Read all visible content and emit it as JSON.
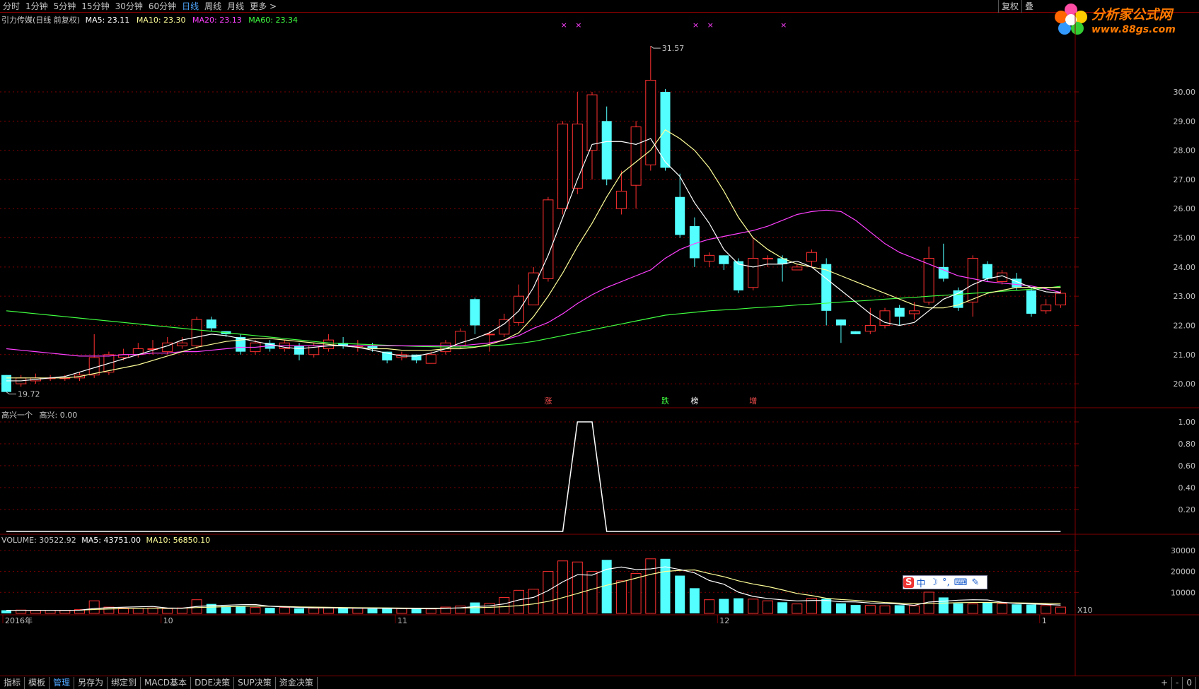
{
  "toolbar": {
    "periods": [
      "分时",
      "1分钟",
      "5分钟",
      "15分钟",
      "30分钟",
      "60分钟",
      "日线",
      "周线",
      "月线",
      "更多 >"
    ],
    "active": "日线",
    "right": [
      "复权",
      "叠"
    ]
  },
  "logo": {
    "name": "分析家公式网",
    "url": "www.88gs.com"
  },
  "main_panel": {
    "title": "引力传媒(日线 前复权)",
    "ma5": "MA5: 23.11",
    "ma10": "MA10: 23.30",
    "ma20": "MA20: 23.13",
    "ma60": "MA60: 23.34",
    "high_label": "31.57",
    "low_label": "19.72",
    "markers": [
      "涨",
      "跌",
      "榜",
      "增"
    ]
  },
  "indicator_panel": {
    "title": "高兴一个",
    "value": "高兴: 0.00"
  },
  "volume_panel": {
    "vol": "VOLUME: 30522.92",
    "ma5": "MA5: 43751.00",
    "ma10": "MA10: 56850.10",
    "unit": "X10"
  },
  "bottom_tabs": [
    "指标",
    "模板",
    "管理",
    "另存为",
    "绑定到",
    "MACD基本",
    "DDE决策",
    "SUP决策",
    "资金决策"
  ],
  "bottom_right": [
    "+",
    "-",
    "0"
  ],
  "x_axis": {
    "labels": [
      "2016年",
      "10",
      "11",
      "12",
      "1"
    ]
  },
  "colors": {
    "up": "#ff3030",
    "down": "#54ffff",
    "ma5": "#ffffff",
    "ma10": "#ffff99",
    "ma20": "#ff40ff",
    "ma60": "#40ff40",
    "grid": "#800000"
  },
  "chart_data": [
    {
      "type": "candlestick",
      "title": "引力传媒(日线 前复权)",
      "y_ticks": [
        "20.00",
        "21.00",
        "22.00",
        "23.00",
        "24.00",
        "25.00",
        "26.00",
        "27.00",
        "28.00",
        "29.00",
        "30.00"
      ],
      "ylim": [
        19.3,
        32.3
      ],
      "candles": [
        [
          20.3,
          19.72,
          20.3,
          19.72
        ],
        [
          20.0,
          20.2,
          20.3,
          19.9
        ],
        [
          20.1,
          20.2,
          20.35,
          20.0
        ],
        [
          20.2,
          20.2,
          20.3,
          20.1
        ],
        [
          20.2,
          20.2,
          20.3,
          20.1
        ],
        [
          20.2,
          20.3,
          20.4,
          20.1
        ],
        [
          20.3,
          20.9,
          21.7,
          20.2
        ],
        [
          20.4,
          21.0,
          21.1,
          20.3
        ],
        [
          20.9,
          21.0,
          21.2,
          20.8
        ],
        [
          21.0,
          21.2,
          21.4,
          20.9
        ],
        [
          21.2,
          21.2,
          21.5,
          21.0
        ],
        [
          21.1,
          21.4,
          21.6,
          21.0
        ],
        [
          21.3,
          21.4,
          21.6,
          21.2
        ],
        [
          21.3,
          22.2,
          22.3,
          21.2
        ],
        [
          22.2,
          21.9,
          22.3,
          21.8
        ],
        [
          21.8,
          21.7,
          21.8,
          21.6
        ],
        [
          21.6,
          21.1,
          21.7,
          21.0
        ],
        [
          21.1,
          21.4,
          21.5,
          21.0
        ],
        [
          21.4,
          21.2,
          21.5,
          21.1
        ],
        [
          21.2,
          21.4,
          21.5,
          21.1
        ],
        [
          21.3,
          21.0,
          21.4,
          20.8
        ],
        [
          21.0,
          21.3,
          21.4,
          20.9
        ],
        [
          21.2,
          21.5,
          21.7,
          21.1
        ],
        [
          21.4,
          21.3,
          21.6,
          21.2
        ],
        [
          21.3,
          21.3,
          21.5,
          21.1
        ],
        [
          21.3,
          21.2,
          21.4,
          21.1
        ],
        [
          21.1,
          20.8,
          21.1,
          20.7
        ],
        [
          20.9,
          21.0,
          21.1,
          20.8
        ],
        [
          21.0,
          20.8,
          21.0,
          20.7
        ],
        [
          20.7,
          21.0,
          21.1,
          20.7
        ],
        [
          21.1,
          21.4,
          21.5,
          21.0
        ],
        [
          21.3,
          21.8,
          21.9,
          21.2
        ],
        [
          22.9,
          22.0,
          22.95,
          21.7
        ],
        [
          21.7,
          21.7,
          21.8,
          21.1
        ],
        [
          21.7,
          22.2,
          22.4,
          21.6
        ],
        [
          22.1,
          23.0,
          23.4,
          22.0
        ],
        [
          22.7,
          23.8,
          24.0,
          22.7
        ],
        [
          23.6,
          26.3,
          26.4,
          23.5
        ],
        [
          26.0,
          28.9,
          29.0,
          25.8
        ],
        [
          26.7,
          28.9,
          30.0,
          26.5
        ],
        [
          28.0,
          29.9,
          30.0,
          27.0
        ],
        [
          29.0,
          27.0,
          29.5,
          26.8
        ],
        [
          26.0,
          26.6,
          27.3,
          25.8
        ],
        [
          26.8,
          28.8,
          29.0,
          26.0
        ],
        [
          27.5,
          30.4,
          31.57,
          27.3
        ],
        [
          30.0,
          27.4,
          30.1,
          27.3
        ],
        [
          26.4,
          25.1,
          27.2,
          25.0
        ],
        [
          25.4,
          24.3,
          25.7,
          24.0
        ],
        [
          24.2,
          24.4,
          24.5,
          24.0
        ],
        [
          24.4,
          24.1,
          24.4,
          23.9
        ],
        [
          24.2,
          23.2,
          24.3,
          23.1
        ],
        [
          23.3,
          24.3,
          25.0,
          23.2
        ],
        [
          24.3,
          24.3,
          24.4,
          24.0
        ],
        [
          24.3,
          24.1,
          24.4,
          23.5
        ],
        [
          23.9,
          24.0,
          24.1,
          23.9
        ],
        [
          24.2,
          24.5,
          24.6,
          24.0
        ],
        [
          24.1,
          22.5,
          24.3,
          22.0
        ],
        [
          22.2,
          22.0,
          22.2,
          21.4
        ],
        [
          21.8,
          21.7,
          21.8,
          21.7
        ],
        [
          21.8,
          22.0,
          22.6,
          21.7
        ],
        [
          22.0,
          22.5,
          22.6,
          21.9
        ],
        [
          22.6,
          22.3,
          22.7,
          22.0
        ],
        [
          22.4,
          22.5,
          22.8,
          22.2
        ],
        [
          22.8,
          24.3,
          24.7,
          22.7
        ],
        [
          24.0,
          23.6,
          24.8,
          23.5
        ],
        [
          23.2,
          22.6,
          23.3,
          22.5
        ],
        [
          22.8,
          24.3,
          24.4,
          22.3
        ],
        [
          24.1,
          23.6,
          24.2,
          23.5
        ],
        [
          23.5,
          23.8,
          23.9,
          23.4
        ],
        [
          23.6,
          23.3,
          23.8,
          23.2
        ],
        [
          23.2,
          22.4,
          23.3,
          22.3
        ],
        [
          22.5,
          22.7,
          22.9,
          22.4
        ],
        [
          22.7,
          23.1,
          23.2,
          22.6
        ]
      ],
      "ma5": [
        20.1,
        20.1,
        20.15,
        20.2,
        20.25,
        20.4,
        20.55,
        20.7,
        20.85,
        21.0,
        21.15,
        21.3,
        21.5,
        21.6,
        21.7,
        21.65,
        21.55,
        21.45,
        21.35,
        21.25,
        21.2,
        21.25,
        21.3,
        21.3,
        21.25,
        21.15,
        21.05,
        20.95,
        20.95,
        21.05,
        21.2,
        21.4,
        21.55,
        21.75,
        22.05,
        22.5,
        23.3,
        24.4,
        25.7,
        27.0,
        28.2,
        28.3,
        28.3,
        28.2,
        28.4,
        27.6,
        27.1,
        26.2,
        25.5,
        24.6,
        24.1,
        24.0,
        24.1,
        24.1,
        24.2,
        24.0,
        23.6,
        23.2,
        22.8,
        22.4,
        22.1,
        22.0,
        22.1,
        22.5,
        22.9,
        23.1,
        23.4,
        23.6,
        23.7,
        23.5,
        23.3,
        23.15,
        23.11
      ],
      "ma10": [
        20.2,
        20.2,
        20.2,
        20.2,
        20.2,
        20.25,
        20.35,
        20.45,
        20.55,
        20.65,
        20.8,
        20.95,
        21.1,
        21.25,
        21.35,
        21.45,
        21.5,
        21.55,
        21.55,
        21.5,
        21.45,
        21.4,
        21.35,
        21.3,
        21.25,
        21.2,
        21.2,
        21.15,
        21.15,
        21.15,
        21.2,
        21.2,
        21.25,
        21.35,
        21.5,
        21.75,
        22.3,
        23.0,
        23.8,
        24.7,
        25.5,
        26.4,
        27.2,
        27.6,
        28.0,
        28.7,
        28.4,
        28.0,
        27.4,
        26.6,
        25.7,
        25.0,
        24.6,
        24.3,
        24.1,
        24.0,
        23.9,
        23.7,
        23.5,
        23.3,
        23.1,
        22.9,
        22.7,
        22.6,
        22.6,
        22.7,
        22.9,
        23.1,
        23.2,
        23.3,
        23.3,
        23.3,
        23.3
      ],
      "ma20": [
        21.2,
        21.15,
        21.1,
        21.05,
        21.0,
        20.95,
        20.95,
        20.95,
        21.0,
        21.0,
        21.05,
        21.05,
        21.1,
        21.1,
        21.15,
        21.2,
        21.25,
        21.25,
        21.3,
        21.3,
        21.3,
        21.3,
        21.3,
        21.3,
        21.3,
        21.3,
        21.3,
        21.3,
        21.3,
        21.3,
        21.3,
        21.3,
        21.35,
        21.4,
        21.5,
        21.65,
        21.9,
        22.1,
        22.4,
        22.75,
        23.05,
        23.3,
        23.5,
        23.7,
        23.9,
        24.3,
        24.6,
        24.8,
        24.95,
        25.05,
        25.15,
        25.25,
        25.4,
        25.6,
        25.8,
        25.9,
        25.95,
        25.9,
        25.6,
        25.2,
        24.8,
        24.5,
        24.3,
        24.1,
        23.9,
        23.7,
        23.6,
        23.5,
        23.45,
        23.4,
        23.35,
        23.25,
        23.13
      ],
      "ma60": [
        22.5,
        22.45,
        22.4,
        22.35,
        22.3,
        22.25,
        22.2,
        22.15,
        22.1,
        22.05,
        22.0,
        21.95,
        21.9,
        21.85,
        21.8,
        21.75,
        21.7,
        21.65,
        21.6,
        21.55,
        21.5,
        21.45,
        21.4,
        21.38,
        21.36,
        21.34,
        21.32,
        21.3,
        21.28,
        21.27,
        21.26,
        21.26,
        21.27,
        21.3,
        21.33,
        21.38,
        21.45,
        21.55,
        21.65,
        21.75,
        21.85,
        21.95,
        22.05,
        22.15,
        22.25,
        22.35,
        22.4,
        22.45,
        22.5,
        22.53,
        22.56,
        22.6,
        22.63,
        22.66,
        22.7,
        22.73,
        22.76,
        22.8,
        22.83,
        22.86,
        22.9,
        22.93,
        22.96,
        23.0,
        23.03,
        23.06,
        23.1,
        23.13,
        23.17,
        23.2,
        23.24,
        23.28,
        23.34
      ],
      "x_label_index": [
        0,
        11,
        27,
        49,
        71
      ]
    },
    {
      "type": "line",
      "title": "高兴一个",
      "y_ticks": [
        "0.20",
        "0.40",
        "0.60",
        "0.80",
        "1.00"
      ],
      "ylim": [
        0,
        1
      ],
      "values": [
        0,
        0,
        0,
        0,
        0,
        0,
        0,
        0,
        0,
        0,
        0,
        0,
        0,
        0,
        0,
        0,
        0,
        0,
        0,
        0,
        0,
        0,
        0,
        0,
        0,
        0,
        0,
        0,
        0,
        0,
        0,
        0,
        0,
        0,
        0,
        0,
        0,
        0,
        0,
        1,
        1,
        0,
        0,
        0,
        0,
        0,
        0,
        0,
        0,
        0,
        0,
        0,
        0,
        0,
        0,
        0,
        0,
        0,
        0,
        0,
        0,
        0,
        0,
        0,
        0,
        0,
        0,
        0,
        0,
        0,
        0,
        0,
        0
      ]
    },
    {
      "type": "bar",
      "title": "VOLUME",
      "y_ticks": [
        "10000",
        "20000",
        "30000"
      ],
      "ylim": [
        0,
        33000
      ],
      "values": [
        1500,
        1600,
        1400,
        1500,
        1400,
        1800,
        6000,
        3000,
        2500,
        2400,
        2600,
        2300,
        2600,
        6500,
        4500,
        3500,
        3600,
        2800,
        2700,
        2800,
        2400,
        2500,
        2600,
        2400,
        2500,
        2200,
        2300,
        2200,
        2400,
        2100,
        3000,
        3500,
        5200,
        4800,
        7600,
        11000,
        11500,
        20000,
        25000,
        24500,
        20000,
        25500,
        15500,
        19000,
        26000,
        26000,
        18000,
        12000,
        6500,
        6900,
        7200,
        6800,
        6000,
        5300,
        4500,
        7100,
        7000,
        4800,
        4000,
        3800,
        3600,
        3900,
        3600,
        10100,
        7600,
        4800,
        4500,
        5100,
        4600,
        4300,
        4200,
        3700,
        3000
      ],
      "ma5": [
        1500,
        1500,
        1500,
        1500,
        1480,
        1540,
        2340,
        2740,
        2940,
        3140,
        3300,
        2560,
        2480,
        3280,
        3700,
        3900,
        4140,
        4200,
        3420,
        3080,
        2860,
        2640,
        2600,
        2540,
        2480,
        2440,
        2400,
        2320,
        2320,
        2240,
        2400,
        2640,
        3240,
        3600,
        4540,
        6420,
        7620,
        10860,
        15020,
        18420,
        18200,
        21000,
        22100,
        20900,
        21200,
        22200,
        20900,
        19300,
        15700,
        13900,
        10100,
        8080,
        7100,
        6440,
        5960,
        6140,
        6140,
        5560,
        5480,
        4940,
        4800,
        4420,
        3860,
        5400,
        5800,
        6300,
        6500,
        6400,
        5300,
        4700,
        4500,
        4260,
        3960
      ],
      "ma10": [
        1500,
        1500,
        1500,
        1500,
        1500,
        1500,
        1900,
        2100,
        2250,
        2350,
        2500,
        2400,
        2450,
        2800,
        3000,
        3200,
        3350,
        3500,
        3400,
        3300,
        3100,
        3000,
        2900,
        2800,
        2700,
        2650,
        2600,
        2550,
        2500,
        2450,
        2500,
        2550,
        2700,
        2900,
        3200,
        3700,
        4500,
        5700,
        7500,
        9500,
        11500,
        13400,
        15000,
        16800,
        18600,
        20000,
        20500,
        20700,
        19000,
        17500,
        15500,
        14000,
        12800,
        11200,
        9500,
        8500,
        7200,
        6600,
        6200,
        5700,
        5200,
        4900,
        4600,
        4700,
        4900,
        5100,
        5200,
        5200,
        5100,
        5000,
        4900,
        4800,
        4700
      ]
    }
  ]
}
